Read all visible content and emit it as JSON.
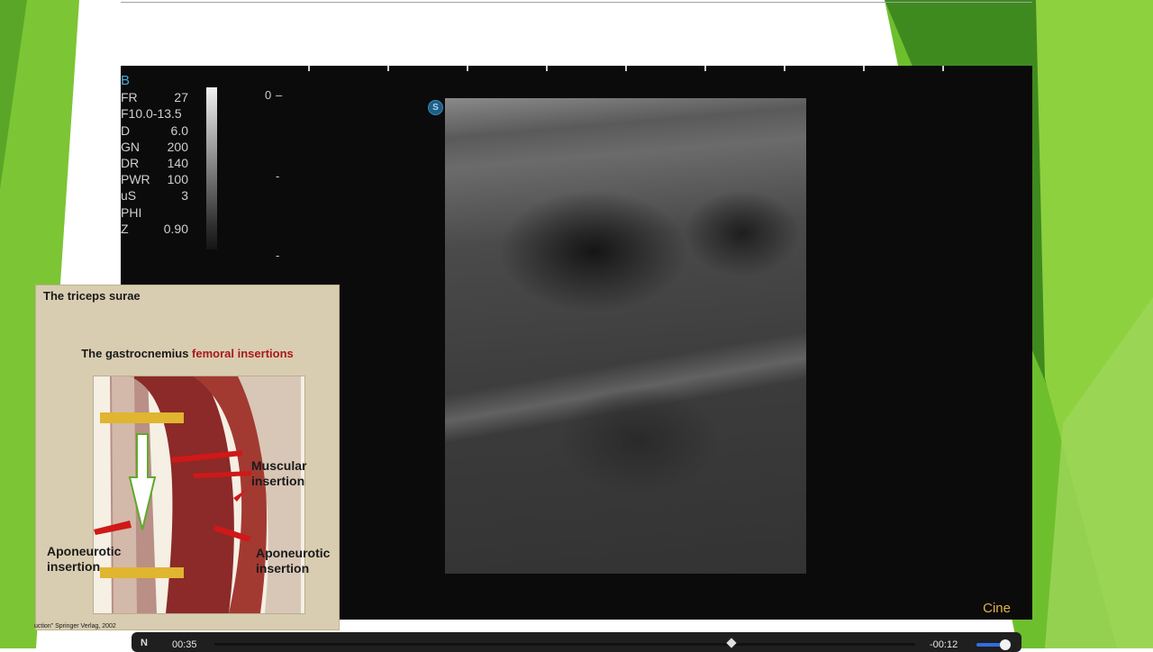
{
  "ultrasound": {
    "mode": "B",
    "params": [
      {
        "key": "FR",
        "value": "27"
      },
      {
        "key": "F10.0-13.5",
        "value": ""
      },
      {
        "key": "D",
        "value": "6.0"
      },
      {
        "key": "GN",
        "value": "200"
      },
      {
        "key": "DR",
        "value": "140"
      },
      {
        "key": "PWR",
        "value": "100"
      },
      {
        "key": "uS",
        "value": "3"
      },
      {
        "key": "PHI",
        "value": ""
      },
      {
        "key": "Z",
        "value": "0.90"
      }
    ],
    "depth_zero": "0",
    "depth_mark_1": "-",
    "depth_mark_2": "-",
    "logo_glyph": "S",
    "cine_label": "Cine"
  },
  "inset": {
    "title": "The triceps surae",
    "subtitle_prefix": "The gastrocnemius ",
    "subtitle_highlight": "femoral insertions",
    "label_muscular": "Muscular insertion",
    "label_aponeurotic_left": "Aponeurotic insertion",
    "label_aponeurotic_right": "Aponeurotic insertion",
    "credit": "uction\" Springer Verlag, 2002"
  },
  "player": {
    "elapsed": "00:35",
    "remaining": "-00:12",
    "progress_fraction": 0.74,
    "volume_fraction": 0.75,
    "icons": [
      "player-logo-icon",
      "playhead-icon",
      "volume-knob-icon"
    ]
  },
  "colors": {
    "slide_green": "#6ebf2e",
    "dark_green": "#3f8a1f",
    "cine_text": "#e0b24a",
    "mode_text": "#4ea7d6",
    "highlight_red": "#a8191c",
    "volume_blue": "#2e6fe0"
  }
}
